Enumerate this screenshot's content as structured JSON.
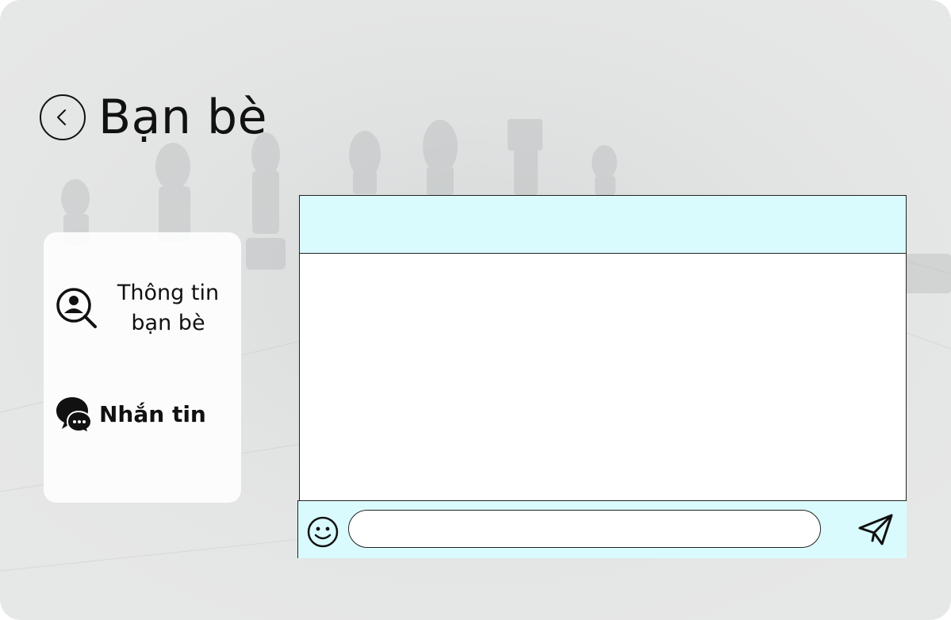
{
  "header": {
    "title": "Bạn bè",
    "back_icon": "chevron-left-circle-icon"
  },
  "sidebar": {
    "items": [
      {
        "label": "Thông tin\nbạn bè",
        "icon": "user-search-icon",
        "active": false
      },
      {
        "label": "Nhắn tin",
        "icon": "chat-bubbles-icon",
        "active": true
      }
    ]
  },
  "chat": {
    "header_color": "#dafbfd",
    "input_value": "",
    "input_placeholder": "",
    "emoji_icon": "smiley-icon",
    "send_icon": "paper-plane-send-icon"
  }
}
